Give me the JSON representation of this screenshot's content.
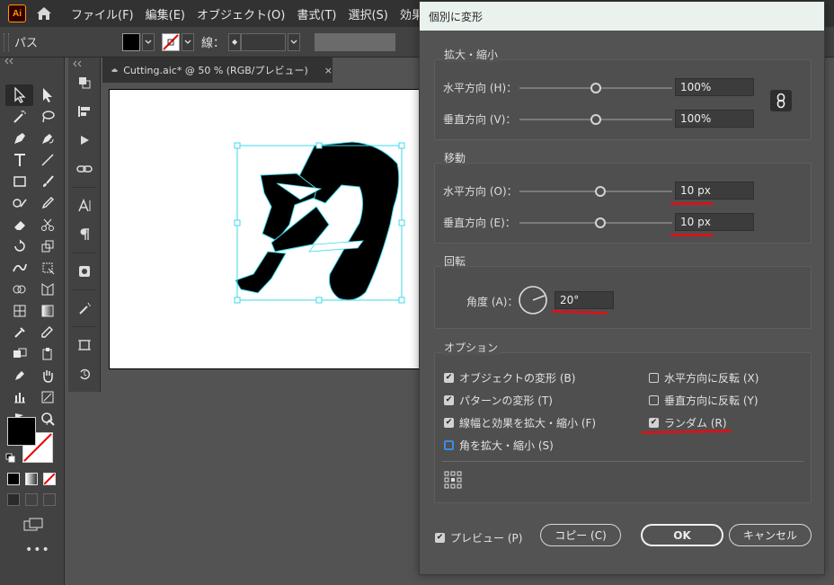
{
  "app": {
    "logo_text": "Ai",
    "menu": [
      "ファイル(F)",
      "編集(E)",
      "オブジェクト(O)",
      "書式(T)",
      "選択(S)",
      "効果"
    ]
  },
  "controlbar": {
    "selection_label": "パス",
    "stroke_label": "線："
  },
  "document": {
    "tab_title": "Cutting.aic* @ 50 % (RGB/プレビュー)",
    "close_glyph": "×"
  },
  "dialog": {
    "title": "個別に変形",
    "scale": {
      "label": "拡大・縮小",
      "horizontal_label": "水平方向 (H)：",
      "horizontal_value": "100%",
      "horizontal_slider": 0.5,
      "vertical_label": "垂直方向 (V)：",
      "vertical_value": "100%",
      "vertical_slider": 0.5
    },
    "move": {
      "label": "移動",
      "horizontal_label": "水平方向 (O)：",
      "horizontal_value": "10 px",
      "horizontal_slider": 0.53,
      "vertical_label": "垂直方向 (E)：",
      "vertical_value": "10 px",
      "vertical_slider": 0.53
    },
    "rotate": {
      "label": "回転",
      "angle_label": "角度 (A)：",
      "angle_value": "20°"
    },
    "options": {
      "label": "オプション",
      "items_left": [
        {
          "label": "オブジェクトの変形 (B)",
          "checked": true
        },
        {
          "label": "パターンの変形 (T)",
          "checked": true
        },
        {
          "label": "線幅と効果を拡大・縮小 (F)",
          "checked": true
        },
        {
          "label": "角を拡大・縮小 (S)",
          "checked": false
        }
      ],
      "items_right": [
        {
          "label": "水平方向に反転 (X)",
          "checked": false
        },
        {
          "label": "垂直方向に反転 (Y)",
          "checked": false
        },
        {
          "label": "ランダム (R)",
          "checked": true
        }
      ]
    },
    "preview_label": "プレビュー (P)",
    "copy_label": "コピー (C)",
    "ok_label": "OK",
    "cancel_label": "キャンセル"
  },
  "colors": {
    "accent_red": "#d0161b",
    "focus_blue": "#3a8de0",
    "selection_cyan": "#3fd9e8",
    "logo_orange": "#ff9a00"
  }
}
